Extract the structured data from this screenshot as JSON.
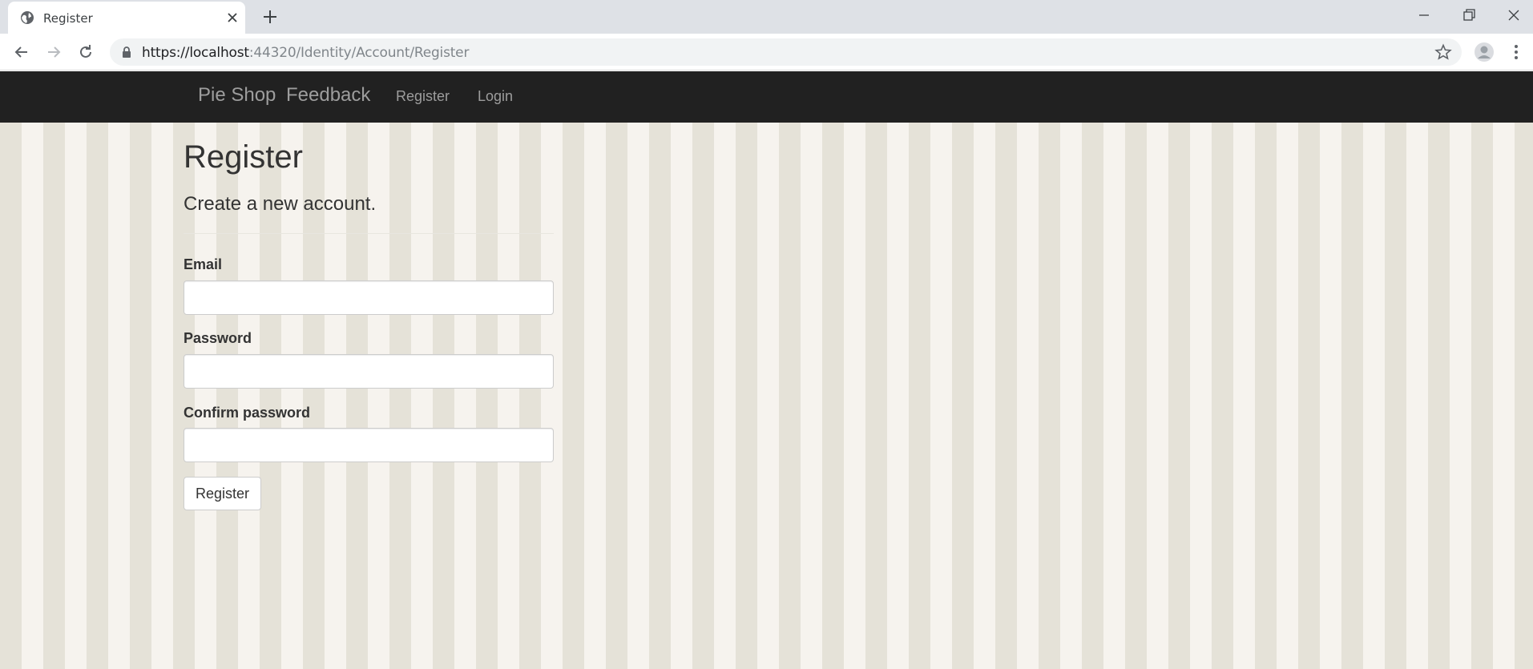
{
  "browser": {
    "tab_title": "Register",
    "url_host": "https://localhost",
    "url_rest": ":44320/Identity/Account/Register"
  },
  "nav": {
    "brand": "Pie Shop",
    "feedback": "Feedback",
    "register": "Register",
    "login": "Login"
  },
  "page": {
    "title": "Register",
    "subtitle": "Create a new account."
  },
  "form": {
    "email_label": "Email",
    "email_value": "",
    "password_label": "Password",
    "password_value": "",
    "confirm_label": "Confirm password",
    "confirm_value": "",
    "submit_label": "Register"
  },
  "colors": {
    "navbar": "#212121",
    "nav_text": "#9d9d9d",
    "stripe_dark": "#e5e2d8",
    "stripe_light": "#f6f3ee"
  },
  "icons": [
    "globe-icon",
    "close-icon",
    "plus-icon",
    "minimize-icon",
    "restore-icon",
    "window-close-icon",
    "back-icon",
    "forward-icon",
    "reload-icon",
    "lock-icon",
    "star-icon",
    "profile-icon",
    "menu-dots-icon"
  ]
}
